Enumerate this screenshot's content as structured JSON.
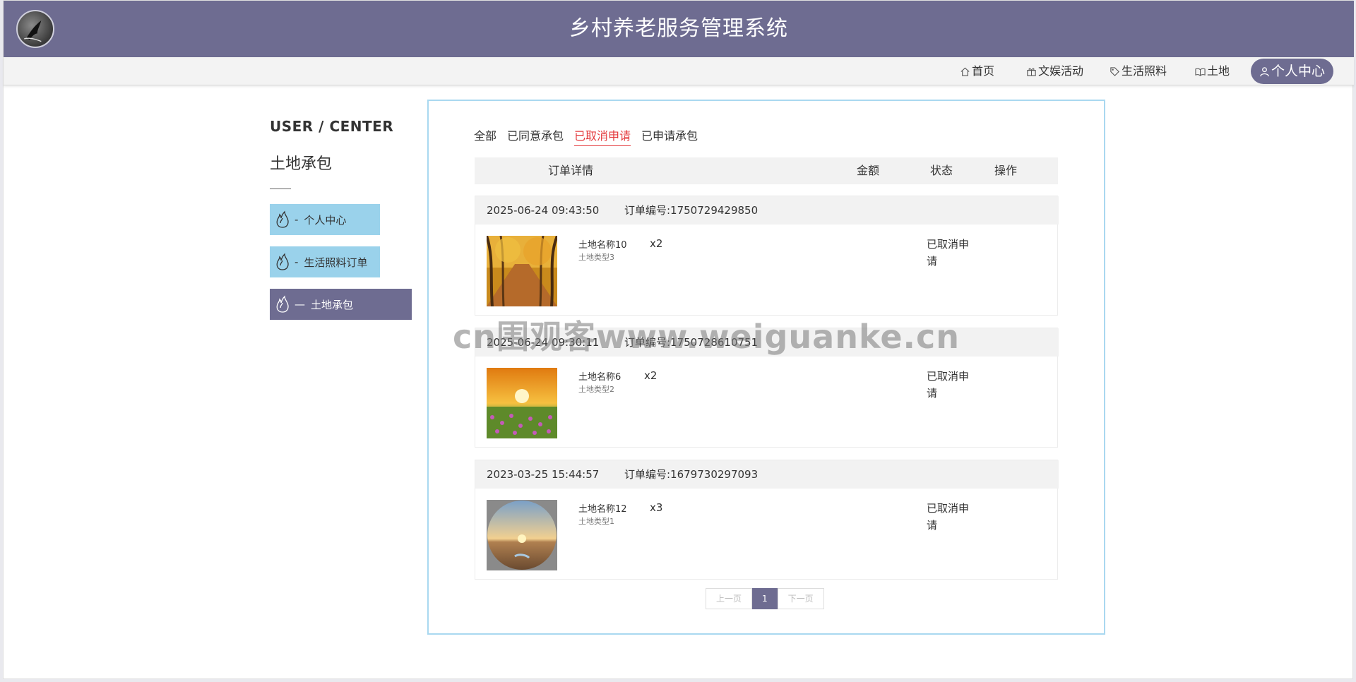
{
  "header": {
    "title": "乡村养老服务管理系统"
  },
  "nav": {
    "items": [
      {
        "label": "首页",
        "icon": "home-icon"
      },
      {
        "label": "文娱活动",
        "icon": "gift-icon"
      },
      {
        "label": "生活照料",
        "icon": "tag-icon"
      },
      {
        "label": "土地",
        "icon": "book-icon"
      },
      {
        "label": "个人中心",
        "icon": "user-icon"
      }
    ]
  },
  "sidebar": {
    "heading": "USER / CENTER",
    "subheading": "土地承包",
    "items": [
      {
        "dash": "-",
        "label": "个人中心",
        "icon": "flame-icon"
      },
      {
        "dash": "-",
        "label": "生活照料订单",
        "icon": "flame-icon"
      },
      {
        "dash": "—",
        "label": "土地承包",
        "icon": "flame-icon"
      }
    ]
  },
  "tabs": [
    "全部",
    "已同意承包",
    "已取消申请",
    "已申请承包"
  ],
  "table_header": {
    "detail": "订单详情",
    "amount": "金额",
    "status": "状态",
    "action": "操作"
  },
  "orders": [
    {
      "time": "2025-06-24 09:43:50",
      "order_no": "订单编号:1750729429850",
      "name": "土地名称10",
      "type": "土地类型3",
      "qty": "x2",
      "status": "已取消申请"
    },
    {
      "time": "2025-06-24 09:30:11",
      "order_no": "订单编号:1750728610751",
      "name": "土地名称6",
      "type": "土地类型2",
      "qty": "x2",
      "status": "已取消申请"
    },
    {
      "time": "2023-03-25 15:44:57",
      "order_no": "订单编号:1679730297093",
      "name": "土地名称12",
      "type": "土地类型1",
      "qty": "x3",
      "status": "已取消申请"
    }
  ],
  "pagination": {
    "prev": "上一页",
    "current": "1",
    "next": "下一页"
  },
  "watermark": "cn围观客www.weiguanke.cn",
  "colors": {
    "header": "#6e6c91",
    "accent_red": "#e4393c",
    "sidebar_light": "#9ad2eb",
    "panel_border": "#a9d8f0"
  }
}
